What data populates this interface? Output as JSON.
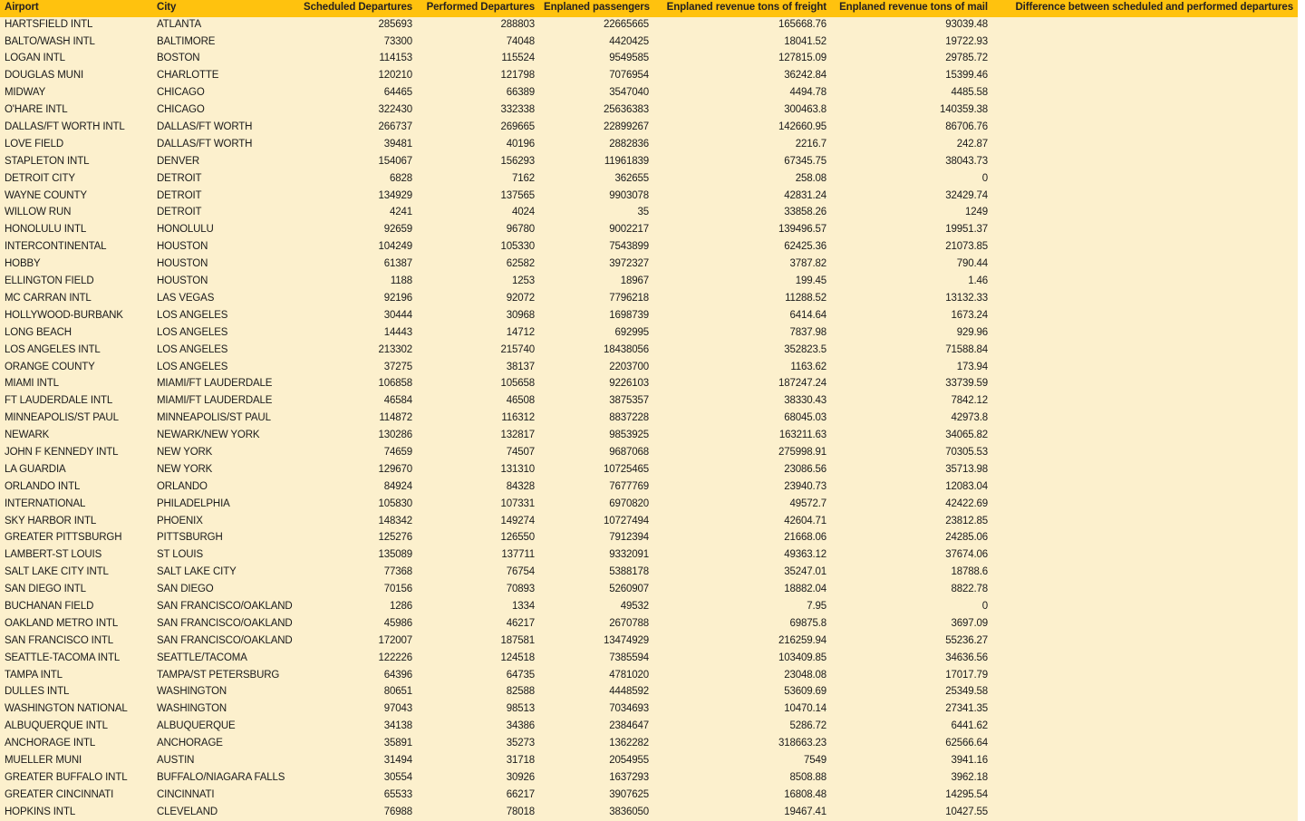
{
  "table": {
    "headers": [
      "Airport",
      "City",
      "Scheduled Departures",
      "Performed Departures",
      "Enplaned passengers",
      "Enplaned revenue tons of freight",
      "Enplaned revenue tons of mail",
      "Difference between scheduled and performed departures"
    ],
    "header_align": [
      "left",
      "left",
      "right",
      "right",
      "right",
      "right",
      "right",
      "right"
    ],
    "colors": {
      "header_background": "#FFC20E",
      "header_text": "#231F20",
      "row_background": "#FCF0CD",
      "row_text": "#1A1A1A",
      "page_background": "#FFFFFF"
    },
    "rows": [
      [
        "HARTSFIELD INTL",
        "ATLANTA",
        "285693",
        "288803",
        "22665665",
        "165668.76",
        "93039.48",
        ""
      ],
      [
        "BALTO/WASH INTL",
        "BALTIMORE",
        "73300",
        "74048",
        "4420425",
        "18041.52",
        "19722.93",
        ""
      ],
      [
        "LOGAN INTL",
        "BOSTON",
        "114153",
        "115524",
        "9549585",
        "127815.09",
        "29785.72",
        ""
      ],
      [
        "DOUGLAS MUNI",
        "CHARLOTTE",
        "120210",
        "121798",
        "7076954",
        "36242.84",
        "15399.46",
        ""
      ],
      [
        "MIDWAY",
        "CHICAGO",
        "64465",
        "66389",
        "3547040",
        "4494.78",
        "4485.58",
        ""
      ],
      [
        "O'HARE INTL",
        "CHICAGO",
        "322430",
        "332338",
        "25636383",
        "300463.8",
        "140359.38",
        ""
      ],
      [
        "DALLAS/FT WORTH INTL",
        "DALLAS/FT WORTH",
        "266737",
        "269665",
        "22899267",
        "142660.95",
        "86706.76",
        ""
      ],
      [
        "LOVE FIELD",
        "DALLAS/FT WORTH",
        "39481",
        "40196",
        "2882836",
        "2216.7",
        "242.87",
        ""
      ],
      [
        "STAPLETON INTL",
        "DENVER",
        "154067",
        "156293",
        "11961839",
        "67345.75",
        "38043.73",
        ""
      ],
      [
        "DETROIT CITY",
        "DETROIT",
        "6828",
        "7162",
        "362655",
        "258.08",
        "0",
        ""
      ],
      [
        "WAYNE COUNTY",
        "DETROIT",
        "134929",
        "137565",
        "9903078",
        "42831.24",
        "32429.74",
        ""
      ],
      [
        "WILLOW RUN",
        "DETROIT",
        "4241",
        "4024",
        "35",
        "33858.26",
        "1249",
        ""
      ],
      [
        "HONOLULU INTL",
        "HONOLULU",
        "92659",
        "96780",
        "9002217",
        "139496.57",
        "19951.37",
        ""
      ],
      [
        "INTERCONTINENTAL",
        "HOUSTON",
        "104249",
        "105330",
        "7543899",
        "62425.36",
        "21073.85",
        ""
      ],
      [
        "HOBBY",
        "HOUSTON",
        "61387",
        "62582",
        "3972327",
        "3787.82",
        "790.44",
        ""
      ],
      [
        "ELLINGTON FIELD",
        "HOUSTON",
        "1188",
        "1253",
        "18967",
        "199.45",
        "1.46",
        ""
      ],
      [
        "MC CARRAN INTL",
        "LAS VEGAS",
        "92196",
        "92072",
        "7796218",
        "11288.52",
        "13132.33",
        ""
      ],
      [
        "HOLLYWOOD-BURBANK",
        "LOS ANGELES",
        "30444",
        "30968",
        "1698739",
        "6414.64",
        "1673.24",
        ""
      ],
      [
        "LONG BEACH",
        "LOS ANGELES",
        "14443",
        "14712",
        "692995",
        "7837.98",
        "929.96",
        ""
      ],
      [
        "LOS ANGELES INTL",
        "LOS ANGELES",
        "213302",
        "215740",
        "18438056",
        "352823.5",
        "71588.84",
        ""
      ],
      [
        "ORANGE COUNTY",
        "LOS ANGELES",
        "37275",
        "38137",
        "2203700",
        "1163.62",
        "173.94",
        ""
      ],
      [
        "MIAMI INTL",
        "MIAMI/FT LAUDERDALE",
        "106858",
        "105658",
        "9226103",
        "187247.24",
        "33739.59",
        ""
      ],
      [
        "FT LAUDERDALE INTL",
        "MIAMI/FT LAUDERDALE",
        "46584",
        "46508",
        "3875357",
        "38330.43",
        "7842.12",
        ""
      ],
      [
        "MINNEAPOLIS/ST PAUL",
        "MINNEAPOLIS/ST PAUL",
        "114872",
        "116312",
        "8837228",
        "68045.03",
        "42973.8",
        ""
      ],
      [
        "NEWARK",
        "NEWARK/NEW YORK",
        "130286",
        "132817",
        "9853925",
        "163211.63",
        "34065.82",
        ""
      ],
      [
        "JOHN F KENNEDY INTL",
        "NEW YORK",
        "74659",
        "74507",
        "9687068",
        "275998.91",
        "70305.53",
        ""
      ],
      [
        "LA GUARDIA",
        "NEW YORK",
        "129670",
        "131310",
        "10725465",
        "23086.56",
        "35713.98",
        ""
      ],
      [
        "ORLANDO INTL",
        "ORLANDO",
        "84924",
        "84328",
        "7677769",
        "23940.73",
        "12083.04",
        ""
      ],
      [
        "INTERNATIONAL",
        "PHILADELPHIA",
        "105830",
        "107331",
        "6970820",
        "49572.7",
        "42422.69",
        ""
      ],
      [
        "SKY HARBOR INTL",
        "PHOENIX",
        "148342",
        "149274",
        "10727494",
        "42604.71",
        "23812.85",
        ""
      ],
      [
        "GREATER PITTSBURGH",
        "PITTSBURGH",
        "125276",
        "126550",
        "7912394",
        "21668.06",
        "24285.06",
        ""
      ],
      [
        "LAMBERT-ST LOUIS",
        "ST LOUIS",
        "135089",
        "137711",
        "9332091",
        "49363.12",
        "37674.06",
        ""
      ],
      [
        "SALT LAKE CITY INTL",
        "SALT LAKE CITY",
        "77368",
        "76754",
        "5388178",
        "35247.01",
        "18788.6",
        ""
      ],
      [
        "SAN DIEGO INTL",
        "SAN DIEGO",
        "70156",
        "70893",
        "5260907",
        "18882.04",
        "8822.78",
        ""
      ],
      [
        "BUCHANAN FIELD",
        "SAN FRANCISCO/OAKLAND",
        "1286",
        "1334",
        "49532",
        "7.95",
        "0",
        ""
      ],
      [
        "OAKLAND METRO INTL",
        "SAN FRANCISCO/OAKLAND",
        "45986",
        "46217",
        "2670788",
        "69875.8",
        "3697.09",
        ""
      ],
      [
        "SAN FRANCISCO INTL",
        "SAN FRANCISCO/OAKLAND",
        "172007",
        "187581",
        "13474929",
        "216259.94",
        "55236.27",
        ""
      ],
      [
        "SEATTLE-TACOMA INTL",
        "SEATTLE/TACOMA",
        "122226",
        "124518",
        "7385594",
        "103409.85",
        "34636.56",
        ""
      ],
      [
        "TAMPA INTL",
        "TAMPA/ST PETERSBURG",
        "64396",
        "64735",
        "4781020",
        "23048.08",
        "17017.79",
        ""
      ],
      [
        "DULLES INTL",
        "WASHINGTON",
        "80651",
        "82588",
        "4448592",
        "53609.69",
        "25349.58",
        ""
      ],
      [
        "WASHINGTON NATIONAL",
        "WASHINGTON",
        "97043",
        "98513",
        "7034693",
        "10470.14",
        "27341.35",
        ""
      ],
      [
        "ALBUQUERQUE INTL",
        "ALBUQUERQUE",
        "34138",
        "34386",
        "2384647",
        "5286.72",
        "6441.62",
        ""
      ],
      [
        "ANCHORAGE INTL",
        "ANCHORAGE",
        "35891",
        "35273",
        "1362282",
        "318663.23",
        "62566.64",
        ""
      ],
      [
        "MUELLER MUNI",
        "AUSTIN",
        "31494",
        "31718",
        "2054955",
        "7549",
        "3941.16",
        ""
      ],
      [
        "GREATER BUFFALO INTL",
        "BUFFALO/NIAGARA FALLS",
        "30554",
        "30926",
        "1637293",
        "8508.88",
        "3962.18",
        ""
      ],
      [
        "GREATER CINCINNATI",
        "CINCINNATI",
        "65533",
        "66217",
        "3907625",
        "16808.48",
        "14295.54",
        ""
      ],
      [
        "HOPKINS INTL",
        "CLEVELAND",
        "76988",
        "78018",
        "3836050",
        "19467.41",
        "10427.55",
        ""
      ]
    ]
  }
}
